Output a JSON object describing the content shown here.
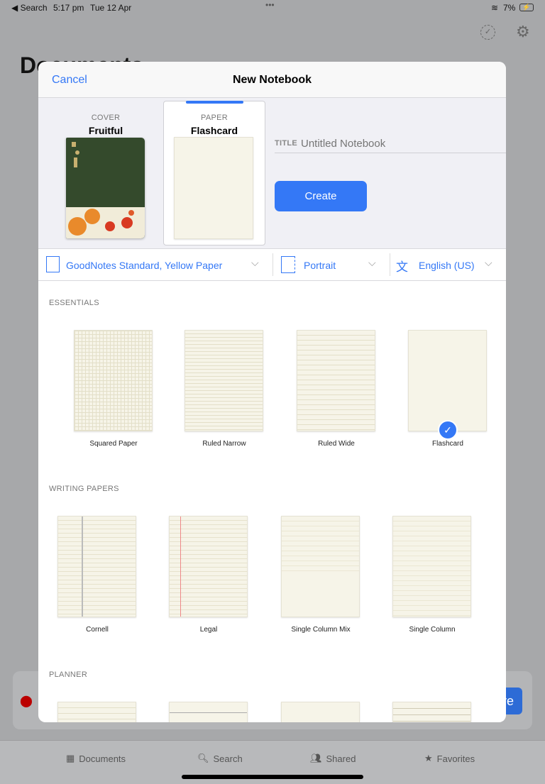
{
  "status_bar": {
    "back": "◀ Search",
    "time": "5:17 pm",
    "date": "Tue 12 Apr",
    "battery": "7%"
  },
  "background": {
    "title": "Documents",
    "tabs": [
      {
        "label": "Documents",
        "icon": "grid-icon"
      },
      {
        "label": "Search",
        "icon": "search-icon"
      },
      {
        "label": "Shared",
        "icon": "people-icon"
      },
      {
        "label": "Favorites",
        "icon": "bookmark-star-icon"
      }
    ],
    "partial_button": "re"
  },
  "modal": {
    "cancel": "Cancel",
    "title": "New Notebook",
    "cover": {
      "caption": "COVER",
      "name": "Fruitful"
    },
    "paper": {
      "caption": "PAPER",
      "name": "Flashcard"
    },
    "title_label": "TITLE",
    "title_placeholder": "Untitled Notebook",
    "create": "Create",
    "template_select": "GoodNotes Standard, Yellow Paper",
    "orientation_select": "Portrait",
    "language_select": "English (US)",
    "sections": [
      {
        "title": "ESSENTIALS",
        "items": [
          "Squared Paper",
          "Ruled Narrow",
          "Ruled Wide",
          "Flashcard"
        ],
        "selected": "Flashcard"
      },
      {
        "title": "WRITING PAPERS",
        "items": [
          "Cornell",
          "Legal",
          "Single Column Mix",
          "Single Column"
        ]
      },
      {
        "title": "PLANNER"
      }
    ]
  },
  "colors": {
    "accent": "#3478f6",
    "paper": "#f6f4e8",
    "cover_green": "#344a2c"
  }
}
